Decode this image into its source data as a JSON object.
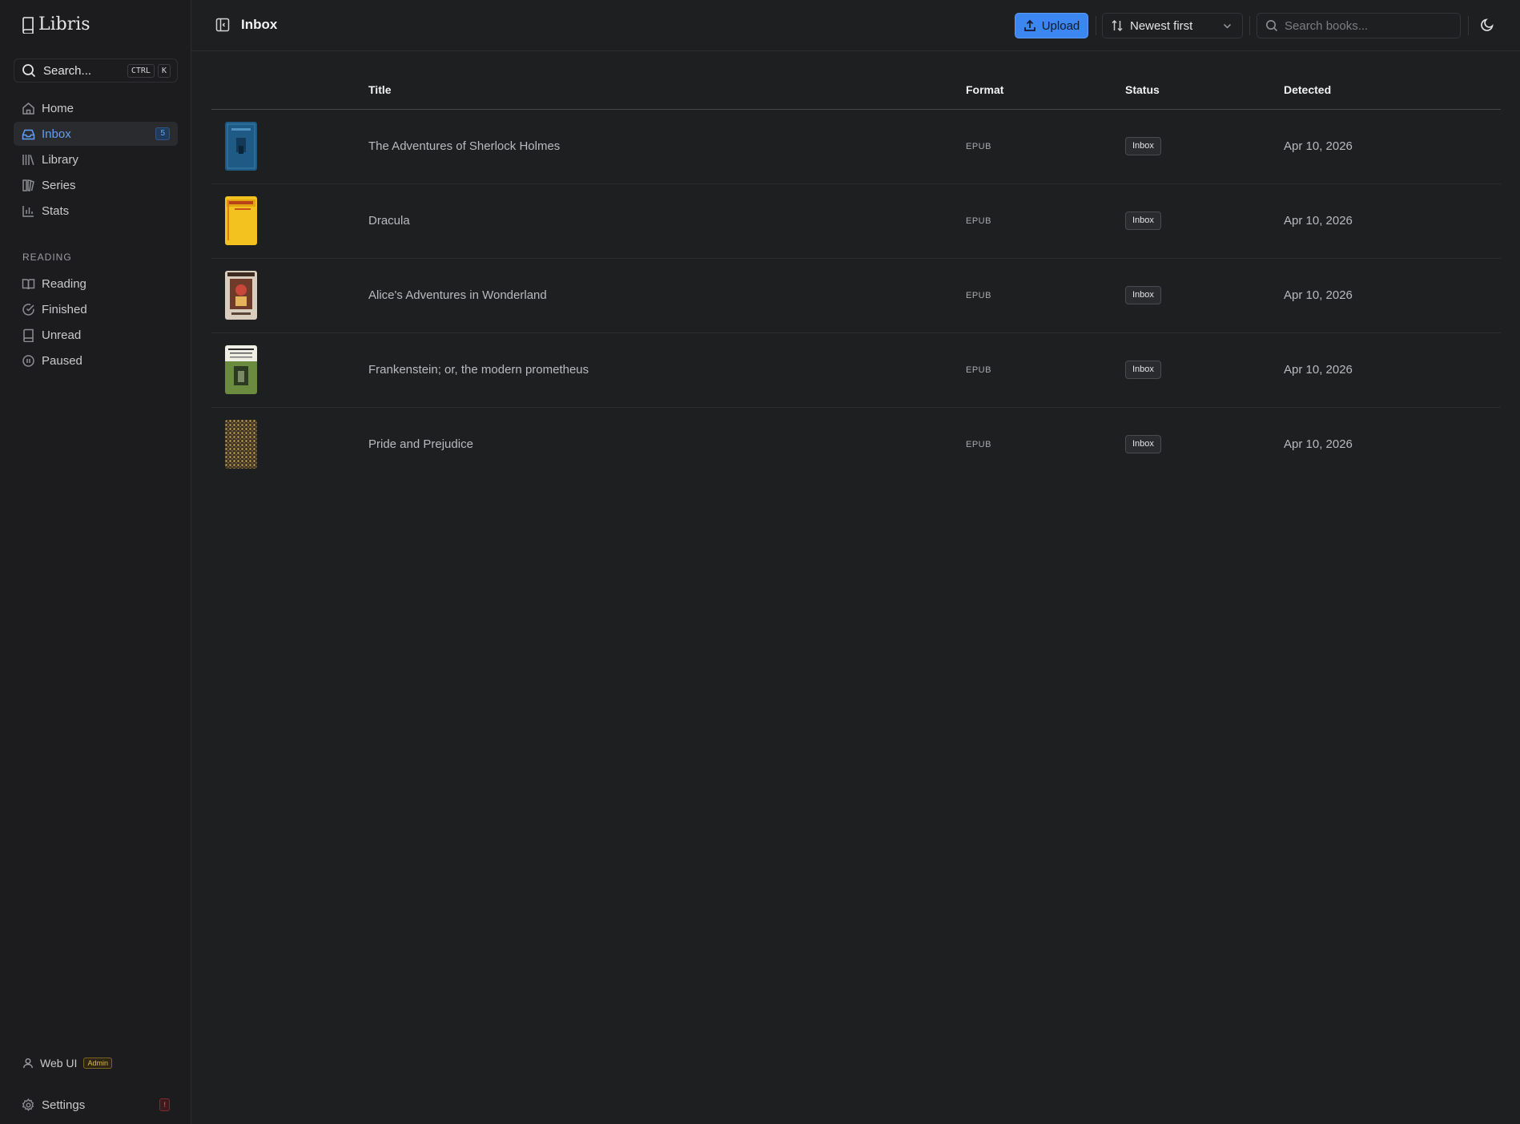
{
  "sidebar": {
    "logo": "Libris",
    "search": {
      "label": "Search...",
      "keys": [
        "CTRL",
        "K"
      ]
    },
    "nav_main": [
      {
        "label": "Home",
        "icon": "home-icon"
      },
      {
        "label": "Inbox",
        "icon": "inbox-icon",
        "badge": "5",
        "active": true
      },
      {
        "label": "Library",
        "icon": "library-icon"
      },
      {
        "label": "Series",
        "icon": "series-icon"
      },
      {
        "label": "Stats",
        "icon": "stats-icon"
      }
    ],
    "reading_section_label": "READING",
    "nav_reading": [
      {
        "label": "Reading",
        "icon": "open-book-icon"
      },
      {
        "label": "Finished",
        "icon": "check-circle-icon"
      },
      {
        "label": "Unread",
        "icon": "closed-book-icon"
      },
      {
        "label": "Paused",
        "icon": "pause-circle-icon"
      }
    ],
    "user": {
      "name": "Web UI",
      "role_badge": "Admin"
    },
    "settings": {
      "label": "Settings",
      "badge": "!"
    }
  },
  "header": {
    "title": "Inbox",
    "upload_label": "Upload",
    "sort": {
      "selected": "Newest first"
    },
    "search": {
      "placeholder": "Search books..."
    }
  },
  "table": {
    "columns": {
      "title": "Title",
      "format": "Format",
      "status": "Status",
      "detected": "Detected"
    },
    "rows": [
      {
        "title": "The Adventures of Sherlock Holmes",
        "format": "EPUB",
        "status": "Inbox",
        "detected": "Apr 10, 2026"
      },
      {
        "title": "Dracula",
        "format": "EPUB",
        "status": "Inbox",
        "detected": "Apr 10, 2026"
      },
      {
        "title": "Alice's Adventures in Wonderland",
        "format": "EPUB",
        "status": "Inbox",
        "detected": "Apr 10, 2026"
      },
      {
        "title": "Frankenstein; or, the modern prometheus",
        "format": "EPUB",
        "status": "Inbox",
        "detected": "Apr 10, 2026"
      },
      {
        "title": "Pride and Prejudice",
        "format": "EPUB",
        "status": "Inbox",
        "detected": "Apr 10, 2026"
      }
    ]
  },
  "colors": {
    "accent": "#3b86f0",
    "background": "#1e1f21",
    "sidebar": "#1c1c1e",
    "admin_badge": "#e0b93f",
    "alert_badge": "#f06c73"
  }
}
